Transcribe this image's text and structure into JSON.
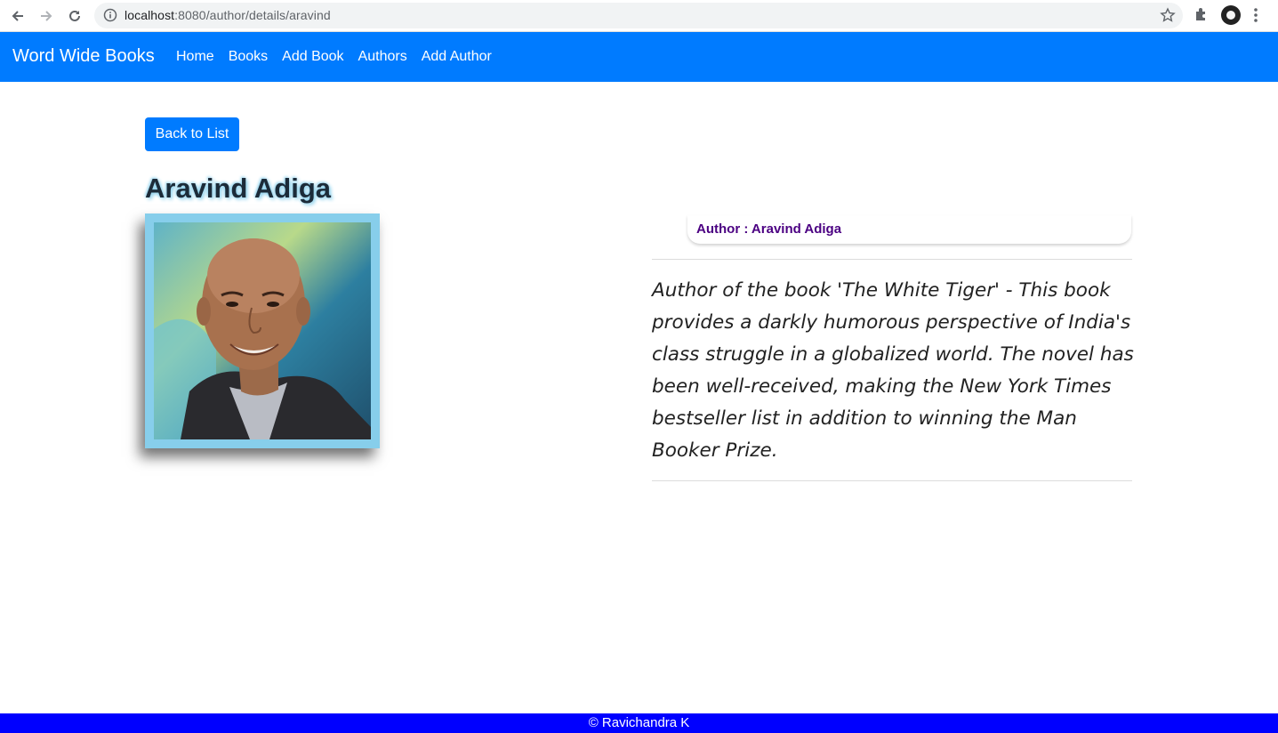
{
  "browser": {
    "url_host": "localhost",
    "url_rest": ":8080/author/details/aravind"
  },
  "navbar": {
    "brand": "Word Wide Books",
    "links": [
      "Home",
      "Books",
      "Add Book",
      "Authors",
      "Add Author"
    ]
  },
  "page": {
    "back_button": "Back to List",
    "author_name": "Aravind Adiga",
    "card_label": "Author : Aravind Adiga",
    "bio": "Author of the book 'The White Tiger' - This book provides a darkly humorous perspective of India's class struggle in a globalized world. The novel has been well-received, making the New York Times bestseller list in addition to winning the Man Booker Prize."
  },
  "footer": {
    "text": "© Ravichandra K"
  },
  "colors": {
    "navbar": "#007bff",
    "footer": "#0000ff",
    "photo_frame": "#87ceeb",
    "card_label": "#4b0082"
  },
  "icons": [
    "back-arrow-icon",
    "forward-arrow-icon",
    "reload-icon",
    "info-icon",
    "star-icon",
    "extensions-icon",
    "profile-avatar",
    "menu-dots-icon"
  ]
}
